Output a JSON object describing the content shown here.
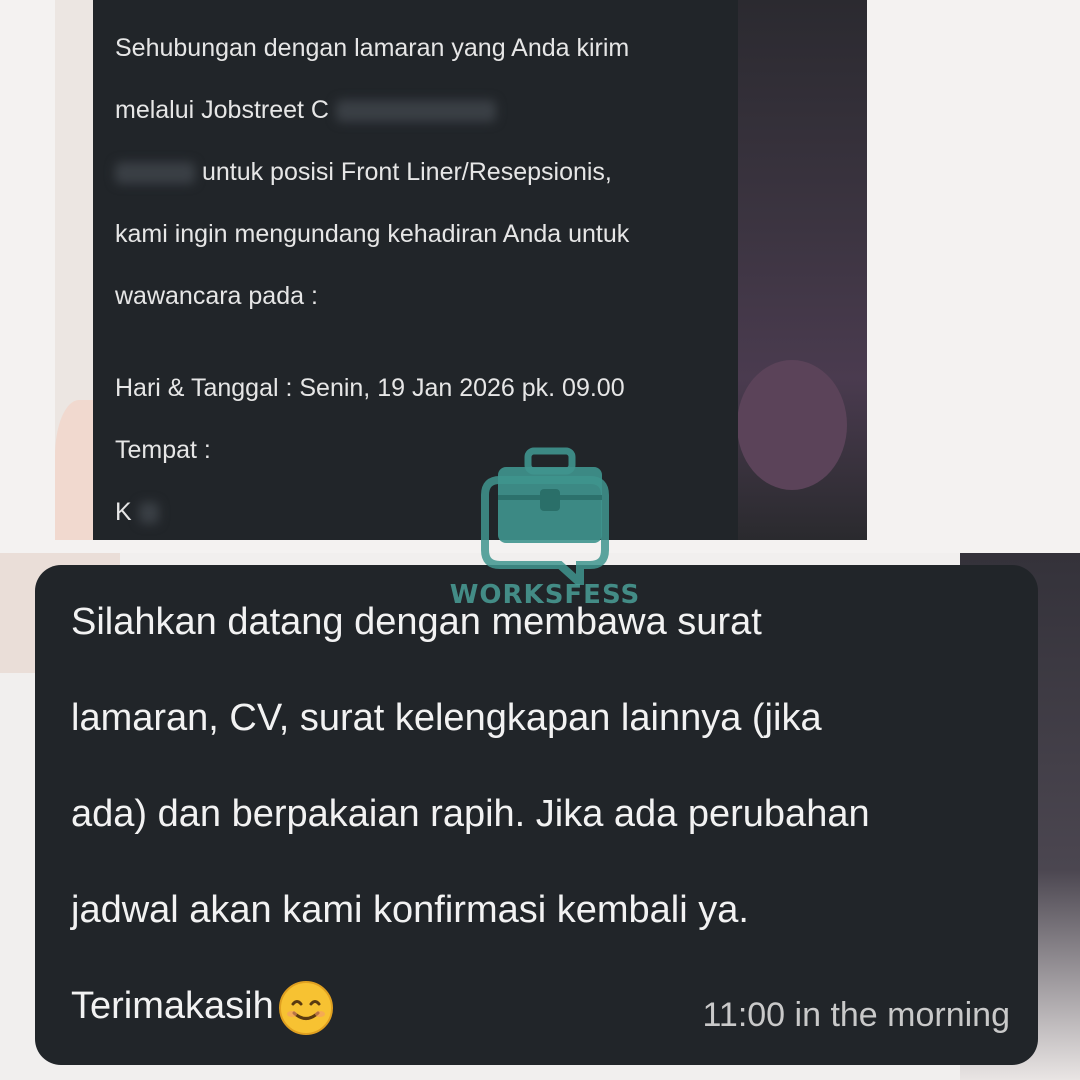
{
  "message_top": {
    "lines": [
      "Sehubungan dengan lamaran yang Anda kirim",
      "melalui Jobstreet C",
      "untuk posisi Front Liner/Resepsionis,",
      "kami ingin mengundang kehadiran Anda untuk",
      "wawancara pada :"
    ],
    "schedule_line": "Hari & Tanggal : Senin, 19 Jan 2026 pk. 09.00",
    "place_label": "Tempat :",
    "place_value_partial": "K"
  },
  "message_bottom": {
    "lines": [
      "Silahkan datang dengan membawa surat",
      "lamaran, CV, surat kelengkapan lainnya (jika",
      "ada) dan berpakaian rapih. Jika ada perubahan",
      "jadwal akan kami konfirmasi kembali ya."
    ],
    "closing": "Terimakasih",
    "emoji": "smiling-face-icon",
    "timestamp": "11:00 in the morning"
  },
  "watermark": {
    "text": "WORKSFESS",
    "icon": "briefcase-chat-icon",
    "color": "#4a9e97"
  },
  "colors": {
    "bubble": "#212529",
    "text": "#e6e6e6",
    "timestamp": "#c9c9c9"
  }
}
